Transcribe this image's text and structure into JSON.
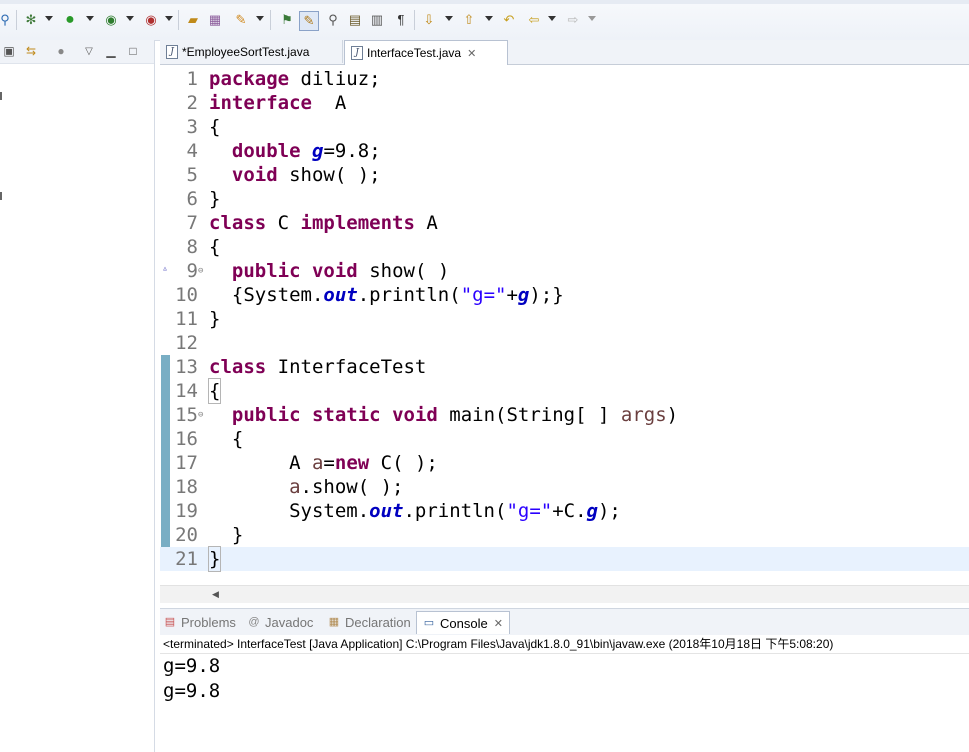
{
  "toolbar": {
    "icons": [
      "search-icon",
      "debug-icon",
      "run-icon",
      "run-coverage-icon",
      "external-tools-icon",
      "open-type-icon",
      "open-folder-icon",
      "build-icon",
      "open-task-icon",
      "toggle-mark-occurrences-icon",
      "search-icon-2",
      "open-page-icon",
      "format-icon",
      "paragraph-icon",
      "next-annotation-icon",
      "previous-annotation-icon",
      "back-icon",
      "back-arrow-icon",
      "forward-arrow-icon"
    ]
  },
  "editor": {
    "tabs": [
      {
        "label": "*EmployeeSortTest.java",
        "active": false
      },
      {
        "label": "InterfaceTest.java",
        "active": true,
        "close": "✕"
      }
    ],
    "lines": [
      {
        "n": "1"
      },
      {
        "n": "2"
      },
      {
        "n": "3"
      },
      {
        "n": "4"
      },
      {
        "n": "5"
      },
      {
        "n": "6"
      },
      {
        "n": "7"
      },
      {
        "n": "8"
      },
      {
        "n": "9"
      },
      {
        "n": "10"
      },
      {
        "n": "11"
      },
      {
        "n": "12"
      },
      {
        "n": "13"
      },
      {
        "n": "14"
      },
      {
        "n": "15"
      },
      {
        "n": "16"
      },
      {
        "n": "17"
      },
      {
        "n": "18"
      },
      {
        "n": "19"
      },
      {
        "n": "20"
      },
      {
        "n": "21"
      }
    ],
    "code": {
      "l1_kw": "package",
      "l1_rest": " diliuz;",
      "l2_kw": "interface",
      "l2_rest": "  A",
      "l3": "{",
      "l4_kw": "double",
      "l4_fld": "g",
      "l4_rest": "=9.8;",
      "l5_kw": "void",
      "l5_rest": " show( );",
      "l6": "}",
      "l7_kw1": "class",
      "l7_mid": " C ",
      "l7_kw2": "implements",
      "l7_rest": " A",
      "l8": "{",
      "l9_kw1": "public",
      "l9_kw2": "void",
      "l9_rest": " show( )",
      "l10_a": "{System.",
      "l10_out": "out",
      "l10_b": ".println(",
      "l10_str": "\"g=\"",
      "l10_c": "+",
      "l10_g": "g",
      "l10_d": ");}",
      "l11": "}",
      "l12": "",
      "l13_kw": "class",
      "l13_rest": " InterfaceTest",
      "l14": "{",
      "l15_kw1": "public",
      "l15_kw2": "static",
      "l15_kw3": "void",
      "l15_rest": " main(String[ ] ",
      "l15_var": "args",
      "l15_end": ")",
      "l16": "{",
      "l17_a": "A ",
      "l17_var": "a",
      "l17_b": "=",
      "l17_kw": "new",
      "l17_c": " C( );",
      "l18_var": "a",
      "l18_rest": ".show( );",
      "l19_a": "System.",
      "l19_out": "out",
      "l19_b": ".println(",
      "l19_str": "\"g=\"",
      "l19_c": "+C.",
      "l19_g": "g",
      "l19_d": ");",
      "l20": "}",
      "l21": "}"
    }
  },
  "bottom": {
    "tabs": [
      {
        "label": "Problems",
        "active": false
      },
      {
        "label": "Javadoc",
        "active": false
      },
      {
        "label": "Declaration",
        "active": false
      },
      {
        "label": "Console",
        "active": true,
        "close": "✕"
      }
    ],
    "status": "<terminated> InterfaceTest [Java Application] C:\\Program Files\\Java\\jdk1.8.0_91\\bin\\javaw.exe (2018年10月18日 下午5:08:20)",
    "output": [
      "g=9.8",
      "g=9.8"
    ]
  },
  "colors": {
    "keyword": "#7f0055",
    "field": "#0000c0",
    "string": "#2a00ff",
    "local_var": "#6a3e3e",
    "current_line": "#e8f2fe",
    "overview_mark": "#79aec4"
  }
}
